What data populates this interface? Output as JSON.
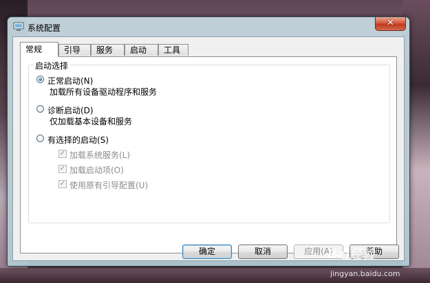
{
  "window": {
    "title": "系统配置",
    "close_label": "✕"
  },
  "tabs": [
    {
      "label": "常规",
      "active": true
    },
    {
      "label": "引导",
      "active": false
    },
    {
      "label": "服务",
      "active": false
    },
    {
      "label": "启动",
      "active": false
    },
    {
      "label": "工具",
      "active": false
    }
  ],
  "startup_group": {
    "title": "启动选择",
    "normal": {
      "label": "正常启动(N)",
      "desc": "加载所有设备驱动程序和服务",
      "checked": true
    },
    "diagnostic": {
      "label": "诊断启动(D)",
      "desc": "仅加载基本设备和服务",
      "checked": false
    },
    "selective": {
      "label": "有选择的启动(S)",
      "checked": false,
      "options": [
        {
          "label": "加载系统服务(L)",
          "checked": true,
          "enabled": false
        },
        {
          "label": "加载启动项(O)",
          "checked": true,
          "enabled": false
        },
        {
          "label": "使用原有引导配置(U)",
          "checked": true,
          "enabled": false
        }
      ]
    }
  },
  "buttons": {
    "ok": "确定",
    "cancel": "取消",
    "apply": "应用(A)",
    "help": "帮助"
  },
  "watermark": {
    "badge": "Bai经验",
    "site": "jingyan.baidu.com"
  },
  "colors": {
    "accent": "#3c7fb1",
    "close_red": "#c1381c",
    "disabled_text": "#8d8d8d"
  },
  "icons": {
    "app": "system-config-icon",
    "close": "close-icon",
    "check": "check-icon"
  }
}
